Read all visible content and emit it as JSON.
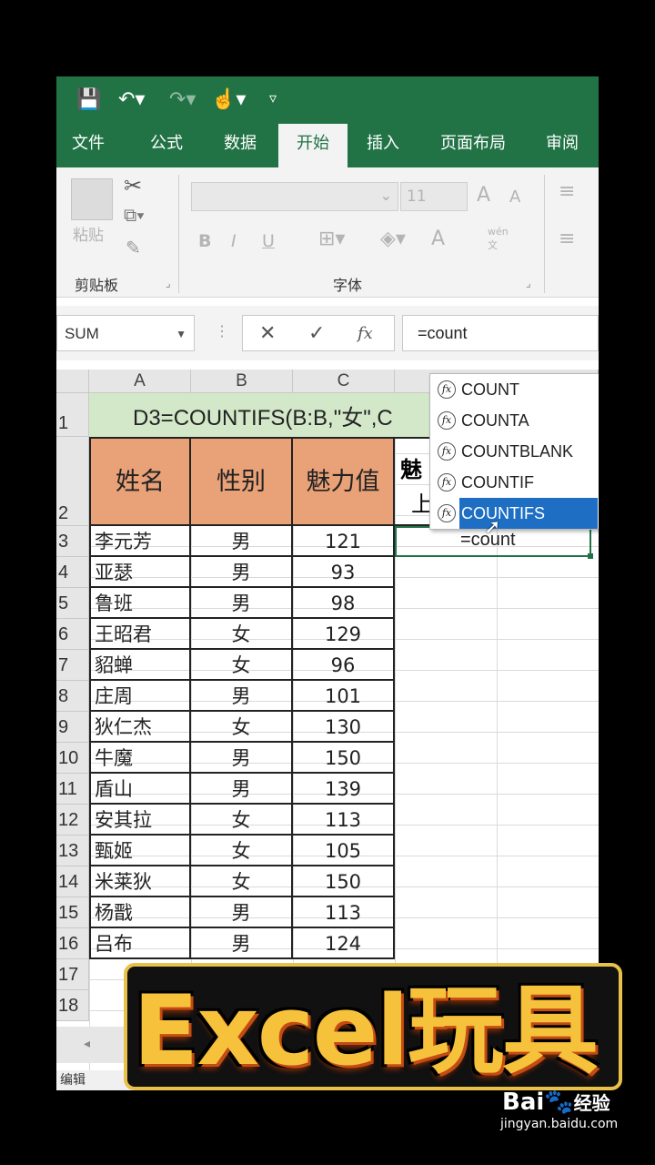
{
  "tabs": [
    "文件",
    "公式",
    "数据",
    "开始",
    "插入",
    "页面布局",
    "审阅"
  ],
  "ribbon": {
    "paste": "粘贴",
    "clipboard_label": "剪贴板",
    "font_label": "字体",
    "font_size": "11",
    "bold": "B",
    "italic": "I",
    "underline": "U",
    "size_up": "A",
    "size_down": "A",
    "font_color": "A",
    "phonetic": "wén",
    "phonetic2": "文"
  },
  "formula_bar": {
    "name_box": "SUM",
    "cancel": "✕",
    "enter": "✓",
    "fx": "fx",
    "value": "=count"
  },
  "columns": [
    "A",
    "B",
    "C"
  ],
  "rows": [
    "1",
    "2",
    "3",
    "4",
    "5",
    "6",
    "7",
    "8",
    "9",
    "10",
    "11",
    "12",
    "13",
    "14",
    "15",
    "16",
    "17",
    "18"
  ],
  "title_row": "D3=COUNTIFS(B:B,\"女\",C",
  "headers": {
    "name": "姓名",
    "gender": "性别",
    "charm": "魅力值",
    "d_partial_1": "魅",
    "d_partial_2": "上"
  },
  "table": [
    {
      "name": "李元芳",
      "gender": "男",
      "value": "121"
    },
    {
      "name": "亚瑟",
      "gender": "男",
      "value": "93"
    },
    {
      "name": "鲁班",
      "gender": "男",
      "value": "98"
    },
    {
      "name": "王昭君",
      "gender": "女",
      "value": "129"
    },
    {
      "name": "貂蝉",
      "gender": "女",
      "value": "96"
    },
    {
      "name": "庄周",
      "gender": "男",
      "value": "101"
    },
    {
      "name": "狄仁杰",
      "gender": "女",
      "value": "130"
    },
    {
      "name": "牛魔",
      "gender": "男",
      "value": "150"
    },
    {
      "name": "盾山",
      "gender": "男",
      "value": "139"
    },
    {
      "name": "安其拉",
      "gender": "女",
      "value": "113"
    },
    {
      "name": "甄姬",
      "gender": "女",
      "value": "105"
    },
    {
      "name": "米莱狄",
      "gender": "女",
      "value": "150"
    },
    {
      "name": "杨戬",
      "gender": "男",
      "value": "113"
    },
    {
      "name": "吕布",
      "gender": "男",
      "value": "124"
    }
  ],
  "active_cell_text": "=count",
  "autocomplete": [
    "COUNT",
    "COUNTA",
    "COUNTBLANK",
    "COUNTIF",
    "COUNTIFS"
  ],
  "autocomplete_selected": "COUNTIFS",
  "status_text": "编辑",
  "banner": "Excel玩具",
  "watermark": {
    "brand": "Bai",
    "brand2": "经验",
    "url": "jingyan.baidu.com"
  },
  "colors": {
    "excel_green": "#217346",
    "header_orange": "#e9a178",
    "title_green": "#d3e8c9",
    "select_blue": "#1e6fc4"
  }
}
